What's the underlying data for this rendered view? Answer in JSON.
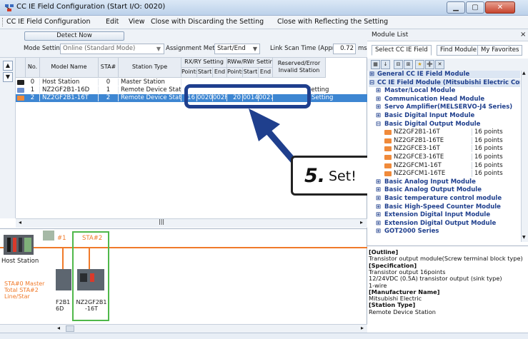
{
  "window": {
    "title": "CC IE Field Configuration (Start I/O: 0020)"
  },
  "menu": [
    "CC IE Field Configuration",
    "Edit",
    "View",
    "Close with Discarding the Setting",
    "Close with Reflecting the Setting"
  ],
  "toolbar": {
    "detect_label": "Detect Now",
    "mode_label": "Mode Setting:",
    "mode_value": "Online (Standard Mode)",
    "assign_label": "Assignment Method:",
    "assign_value": "Start/End",
    "scan_label": "Link Scan Time (Approx.):",
    "scan_value": "0.72",
    "scan_unit": "ms"
  },
  "grid": {
    "headers": {
      "no": "No.",
      "model": "Model Name",
      "sta": "STA#",
      "type": "Station Type",
      "rxry": "RX/RY Setting",
      "rwwr": "RWw/RWr Setting",
      "points": "Points",
      "start": "Start",
      "end": "End",
      "reserved": "Reserved/Error Invalid Station"
    },
    "rows": [
      {
        "no": "0",
        "model": "Host Station",
        "sta": "0",
        "type": "Master Station",
        "rx_points": "",
        "rx_start": "",
        "rx_end": "",
        "rw_points": "",
        "rw_start": "",
        "rw_end": "",
        "reserved": ""
      },
      {
        "no": "1",
        "model": "NZ2GF2B1-16D",
        "sta": "1",
        "type": "Remote Device Station",
        "rx_points": "",
        "rx_start": "",
        "rx_end": "",
        "rw_points": "",
        "rw_start": "",
        "rw_end": "",
        "reserved": "Setting"
      },
      {
        "no": "2",
        "model": "NZ2GF2B1-16T",
        "sta": "2",
        "type": "Remote Device Station",
        "rx_points": "16",
        "rx_start": "0020",
        "rx_end": "002F",
        "rw_points": "20",
        "rw_start": "0014",
        "rw_end": "0027",
        "reserved": "Setting"
      }
    ]
  },
  "callout": {
    "number": "5.",
    "text": "Set!"
  },
  "topology": {
    "sta1_label": "#1",
    "sta2_label": "STA#2",
    "host_label": "Host Station",
    "summary": [
      "STA#0  Master",
      "Total STA#2",
      "Line/Star"
    ],
    "sta1_name": [
      "F2B1",
      "6D"
    ],
    "sta2_name": [
      "NZ2GF2B1",
      "-16T"
    ]
  },
  "module_list": {
    "title": "Module List",
    "tabs": [
      "Select CC IE Field",
      "Find Module",
      "My Favorites"
    ],
    "tree": [
      {
        "label": "General CC IE Field Module",
        "kind": "cat",
        "prefix": "⊞"
      },
      {
        "label": "CC IE Field Module (Mitsubishi Electric Corporati",
        "kind": "cat",
        "prefix": "⊟"
      },
      {
        "label": "Master/Local Module",
        "kind": "sub",
        "prefix": "⊞"
      },
      {
        "label": "Communication Head Module",
        "kind": "sub",
        "prefix": "⊞"
      },
      {
        "label": "Servo Amplifier(MELSERVO-J4 Series)",
        "kind": "sub",
        "prefix": "⊞"
      },
      {
        "label": "Basic Digital Input Module",
        "kind": "sub",
        "prefix": "⊞"
      },
      {
        "label": "Basic Digital Output Module",
        "kind": "sub",
        "prefix": "⊟"
      },
      {
        "label": "NZ2GF2B1-16T",
        "kind": "item",
        "points": "16 points"
      },
      {
        "label": "NZ2GF2B1-16TE",
        "kind": "item",
        "points": "16 points"
      },
      {
        "label": "NZ2GFCE3-16T",
        "kind": "item",
        "points": "16 points"
      },
      {
        "label": "NZ2GFCE3-16TE",
        "kind": "item",
        "points": "16 points"
      },
      {
        "label": "NZ2GFCM1-16T",
        "kind": "item",
        "points": "16 points"
      },
      {
        "label": "NZ2GFCM1-16TE",
        "kind": "item",
        "points": "16 points"
      },
      {
        "label": "Basic Analog Input Module",
        "kind": "sub",
        "prefix": "⊞"
      },
      {
        "label": "Basic Analog Output Module",
        "kind": "sub",
        "prefix": "⊞"
      },
      {
        "label": "Basic temperature control module",
        "kind": "sub",
        "prefix": "⊞"
      },
      {
        "label": "Basic High-Speed Counter Module",
        "kind": "sub",
        "prefix": "⊞"
      },
      {
        "label": "Extension Digital Input Module",
        "kind": "sub",
        "prefix": "⊞"
      },
      {
        "label": "Extension Digital Output Module",
        "kind": "sub",
        "prefix": "⊞"
      },
      {
        "label": "GOT2000 Series",
        "kind": "sub",
        "prefix": "⊞"
      }
    ],
    "info": [
      {
        "text": "[Outline]",
        "bold": true
      },
      {
        "text": "Transistor output module(Screw terminal block type)",
        "bold": false
      },
      {
        "text": "[Specification]",
        "bold": true
      },
      {
        "text": "Transistor output 16points",
        "bold": false
      },
      {
        "text": "12/24VDC (0.5A) transistor output (sink type)",
        "bold": false
      },
      {
        "text": "1-wire",
        "bold": false
      },
      {
        "text": "[Manufacturer Name]",
        "bold": true
      },
      {
        "text": "Mitsubishi Electric",
        "bold": false
      },
      {
        "text": "[Station Type]",
        "bold": true
      },
      {
        "text": "Remote Device Station",
        "bold": false
      }
    ]
  },
  "colors": {
    "selection": "#3d86d2",
    "highlight": "#1f3f8d",
    "station_line": "#f07a2a",
    "sta2_frame": "#4fb84a"
  }
}
